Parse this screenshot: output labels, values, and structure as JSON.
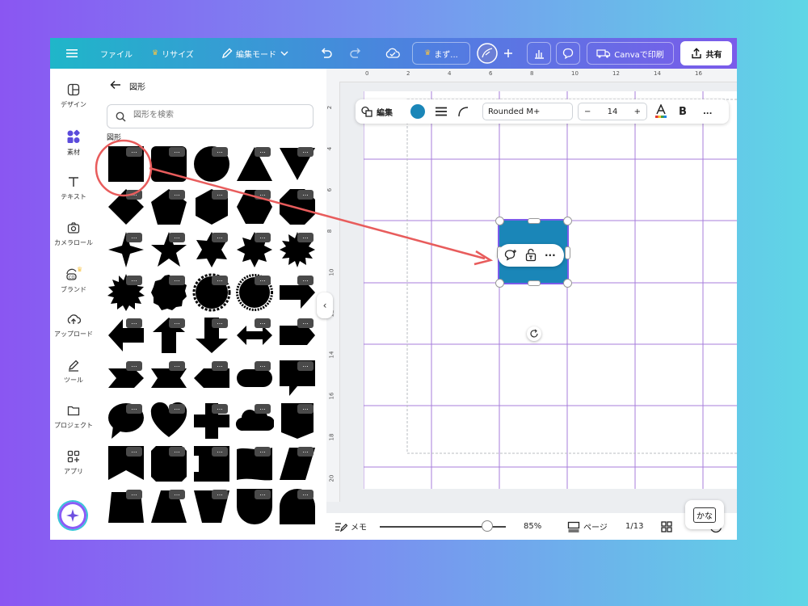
{
  "topbar": {
    "menu_icon": "hamburger-icon",
    "file_label": "ファイル",
    "resize_label": "リサイズ",
    "edit_mode_label": "編集モード",
    "premium_label": "まず...",
    "share_label": "共有",
    "print_label": "Canvaで印刷"
  },
  "rail": {
    "items": [
      {
        "label": "デザイン",
        "icon": "design-icon"
      },
      {
        "label": "素材",
        "icon": "elements-icon"
      },
      {
        "label": "テキスト",
        "icon": "text-icon"
      },
      {
        "label": "カメラロール",
        "icon": "camera-icon"
      },
      {
        "label": "ブランド",
        "icon": "brand-icon"
      },
      {
        "label": "アップロード",
        "icon": "upload-icon"
      },
      {
        "label": "ツール",
        "icon": "tool-icon"
      },
      {
        "label": "プロジェクト",
        "icon": "folder-icon"
      },
      {
        "label": "アプリ",
        "icon": "apps-icon"
      }
    ]
  },
  "panel": {
    "title": "図形",
    "search_placeholder": "図形を検索",
    "section_label": "図形",
    "more_label": "..."
  },
  "toolbar": {
    "edit_label": "編集",
    "color": "#1a86b8",
    "font_name": "Rounded M+",
    "font_size": "14",
    "minus": "−",
    "plus": "+",
    "bold": "B",
    "more": "..."
  },
  "rulers": {
    "horizontal": [
      "0",
      "2",
      "4",
      "6",
      "8",
      "10",
      "12",
      "14",
      "16"
    ],
    "vertical": [
      "2",
      "4",
      "6",
      "8",
      "10",
      "12",
      "14",
      "16",
      "18",
      "20"
    ]
  },
  "bottombar": {
    "memo_label": "メモ",
    "zoom_value": 0.85,
    "zoom_label": "85%",
    "page_label": "ページ",
    "page_count": "1/13"
  },
  "kana_label": "かな",
  "colors": {
    "accent": "#e85c5c",
    "shape_fill": "#1a86b8",
    "grid_line": "#a77ddb"
  }
}
